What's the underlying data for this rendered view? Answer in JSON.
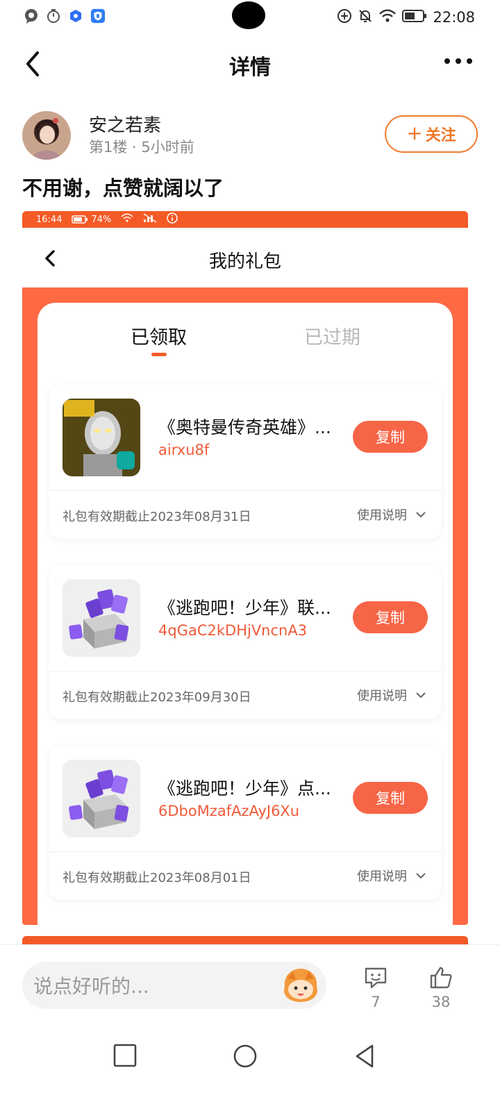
{
  "status_bar": {
    "time": "22:08",
    "left_icons": [
      "chat-bubble-icon",
      "timer-icon",
      "blue-app-icon",
      "shield-app-icon"
    ],
    "right_icons": [
      "add-circle-icon",
      "mute-bell-icon",
      "wifi-icon",
      "battery-icon"
    ]
  },
  "header": {
    "title": "详情",
    "back_icon": "chevron-left-icon",
    "more_icon": "more-dots-icon"
  },
  "post": {
    "author_name": "安之若素",
    "meta": "第1楼 · 5小时前",
    "follow_label": "关注",
    "follow_icon": "+",
    "text": "不用谢，点赞就阔以了"
  },
  "screenshot": {
    "status": {
      "time": "16:44",
      "battery": "74%"
    },
    "title": "我的礼包",
    "tabs": [
      {
        "label": "已领取",
        "active": true
      },
      {
        "label": "已过期",
        "active": false
      }
    ],
    "gifts": [
      {
        "name": "《奥特曼传奇英雄》...",
        "code": "airxu8f",
        "copy_label": "复制",
        "expiry": "礼包有效期截止2023年08月31日",
        "help_label": "使用说明",
        "icon": "ultraman-game-icon"
      },
      {
        "name": "《逃跑吧！少年》联...",
        "code": "4qGaC2kDHjVncnA3",
        "copy_label": "复制",
        "expiry": "礼包有效期截止2023年09月30日",
        "help_label": "使用说明",
        "icon": "gift-box-icon"
      },
      {
        "name": "《逃跑吧！少年》点...",
        "code": "6DboMzafAzAyJ6Xu",
        "copy_label": "复制",
        "expiry": "礼包有效期截止2023年08月01日",
        "help_label": "使用说明",
        "icon": "gift-box-icon"
      }
    ]
  },
  "bottom_bar": {
    "comment_placeholder": "说点好听的...",
    "comment_count": "7",
    "like_count": "38"
  },
  "colors": {
    "accent": "#f45a26",
    "follow": "#f27a2c",
    "copy_button": "#f76547",
    "panel_bg": "#ff6a45"
  }
}
